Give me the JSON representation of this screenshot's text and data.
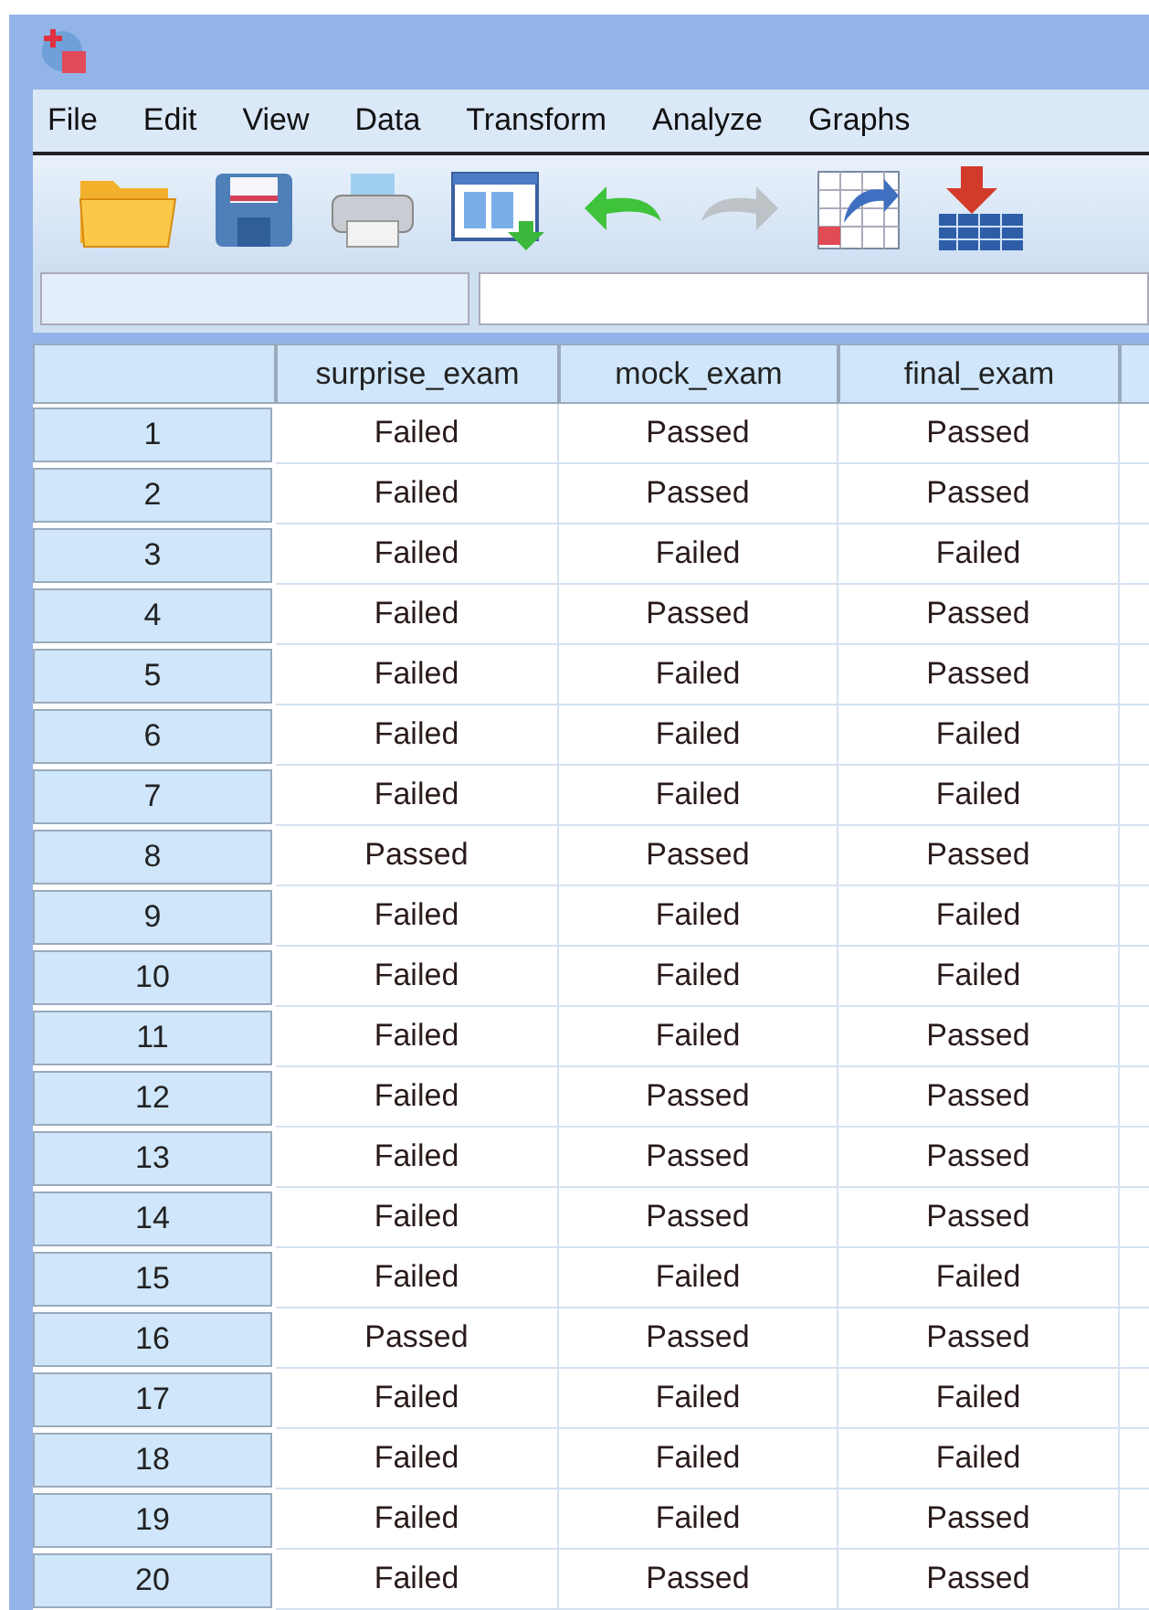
{
  "menu": [
    "File",
    "Edit",
    "View",
    "Data",
    "Transform",
    "Analyze",
    "Graphs"
  ],
  "toolbar": [
    {
      "kind": "folder",
      "disabled": false
    },
    {
      "kind": "save",
      "disabled": false
    },
    {
      "kind": "print",
      "disabled": false
    },
    {
      "kind": "dialog",
      "disabled": false
    },
    {
      "kind": "undo",
      "disabled": false
    },
    {
      "kind": "redo",
      "disabled": true
    },
    {
      "kind": "goto",
      "disabled": false
    },
    {
      "kind": "insert",
      "disabled": false
    }
  ],
  "table": {
    "columns": [
      "surprise_exam",
      "mock_exam",
      "final_exam"
    ],
    "rows": [
      {
        "number": "1",
        "cells": [
          "Failed",
          "Passed",
          "Passed"
        ]
      },
      {
        "number": "2",
        "cells": [
          "Failed",
          "Passed",
          "Passed"
        ]
      },
      {
        "number": "3",
        "cells": [
          "Failed",
          "Failed",
          "Failed"
        ]
      },
      {
        "number": "4",
        "cells": [
          "Failed",
          "Passed",
          "Passed"
        ]
      },
      {
        "number": "5",
        "cells": [
          "Failed",
          "Failed",
          "Passed"
        ]
      },
      {
        "number": "6",
        "cells": [
          "Failed",
          "Failed",
          "Failed"
        ]
      },
      {
        "number": "7",
        "cells": [
          "Failed",
          "Failed",
          "Failed"
        ]
      },
      {
        "number": "8",
        "cells": [
          "Passed",
          "Passed",
          "Passed"
        ]
      },
      {
        "number": "9",
        "cells": [
          "Failed",
          "Failed",
          "Failed"
        ]
      },
      {
        "number": "10",
        "cells": [
          "Failed",
          "Failed",
          "Failed"
        ]
      },
      {
        "number": "11",
        "cells": [
          "Failed",
          "Failed",
          "Passed"
        ]
      },
      {
        "number": "12",
        "cells": [
          "Failed",
          "Passed",
          "Passed"
        ]
      },
      {
        "number": "13",
        "cells": [
          "Failed",
          "Passed",
          "Passed"
        ]
      },
      {
        "number": "14",
        "cells": [
          "Failed",
          "Passed",
          "Passed"
        ]
      },
      {
        "number": "15",
        "cells": [
          "Failed",
          "Failed",
          "Failed"
        ]
      },
      {
        "number": "16",
        "cells": [
          "Passed",
          "Passed",
          "Passed"
        ]
      },
      {
        "number": "17",
        "cells": [
          "Failed",
          "Failed",
          "Failed"
        ]
      },
      {
        "number": "18",
        "cells": [
          "Failed",
          "Failed",
          "Failed"
        ]
      },
      {
        "number": "19",
        "cells": [
          "Failed",
          "Failed",
          "Passed"
        ]
      },
      {
        "number": "20",
        "cells": [
          "Failed",
          "Passed",
          "Passed"
        ]
      }
    ]
  }
}
